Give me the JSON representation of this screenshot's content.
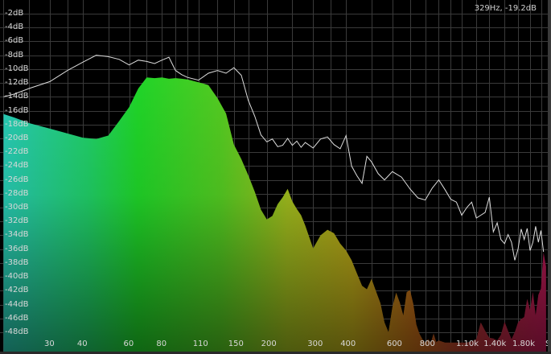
{
  "readout": {
    "frequency": "329Hz",
    "level": "-19.2dB",
    "text": "329Hz, -19.2dB"
  },
  "y_labels": [
    "-2dB",
    "-4dB",
    "-6dB",
    "-8dB",
    "-10dB",
    "-12dB",
    "-14dB",
    "-16dB",
    "-18dB",
    "-20dB",
    "-22dB",
    "-24dB",
    "-26dB",
    "-28dB",
    "-30dB",
    "-32dB",
    "-34dB",
    "-36dB",
    "-38dB",
    "-40dB",
    "-42dB",
    "-44dB",
    "-46dB",
    "-48dB"
  ],
  "x_labels": [
    "30",
    "40",
    "60",
    "80",
    "110",
    "150",
    "200",
    "300",
    "400",
    "600",
    "800",
    "1.10k",
    "1.40k",
    "1.80k",
    "S"
  ],
  "colors": {
    "background": "#000000",
    "grid": "#3a3a3a",
    "peak_line": "#dddddd",
    "spectrum_low": "#2ad3c0",
    "spectrum_mid": "#22e028",
    "spectrum_highmid": "#c9c21c",
    "spectrum_high": "#c2185b"
  },
  "chart_data": {
    "type": "area",
    "xscale": "log",
    "xlabel": "",
    "ylabel": "",
    "ylim": [
      -49,
      -1
    ],
    "xlim": [
      20,
      2300
    ],
    "grid": true,
    "series": [
      {
        "kind": "peak-hold",
        "x": [
          20,
          22,
          25,
          30,
          35,
          40,
          45,
          50,
          55,
          60,
          65,
          70,
          75,
          80,
          85,
          90,
          95,
          100,
          110,
          120,
          130,
          140,
          150,
          160,
          170,
          180,
          190,
          200,
          210,
          220,
          230,
          240,
          250,
          260,
          270,
          280,
          300,
          320,
          340,
          360,
          380,
          400,
          420,
          440,
          460,
          480,
          500,
          530,
          560,
          600,
          650,
          700,
          750,
          800,
          850,
          900,
          950,
          1000,
          1050,
          1100,
          1150,
          1200,
          1250,
          1300,
          1350,
          1400,
          1450,
          1500,
          1550,
          1600,
          1650,
          1700,
          1750,
          1800,
          1850,
          1900,
          1950,
          2000,
          2050,
          2100,
          2150,
          2200,
          2250
        ],
        "y": [
          -14,
          -13.6,
          -12.8,
          -11.8,
          -10.2,
          -9.0,
          -8.0,
          -8.2,
          -8.6,
          -9.4,
          -8.7,
          -8.9,
          -9.2,
          -8.7,
          -8.3,
          -10.2,
          -10.8,
          -11.2,
          -11.6,
          -10.6,
          -10.2,
          -10.6,
          -9.8,
          -10.9,
          -14.5,
          -16.8,
          -19.5,
          -20.5,
          -20.1,
          -21.2,
          -21.0,
          -20.0,
          -21.0,
          -20.4,
          -21.3,
          -20.6,
          -21.4,
          -20.1,
          -19.8,
          -20.9,
          -21.5,
          -19.6,
          -24.0,
          -25.4,
          -26.5,
          -22.6,
          -23.4,
          -25.1,
          -26.0,
          -24.8,
          -25.6,
          -27.3,
          -28.6,
          -28.9,
          -27.2,
          -26.0,
          -27.4,
          -28.8,
          -29.2,
          -31.1,
          -30.0,
          -29.2,
          -31.5,
          -31.1,
          -30.7,
          -28.5,
          -33.5,
          -32.2,
          -34.6,
          -35.2,
          -33.9,
          -35.0,
          -37.6,
          -36.0,
          -33.1,
          -34.6,
          -33.0,
          -36.2,
          -35.0,
          -32.7,
          -35.0,
          -33.3,
          -36.4
        ]
      },
      {
        "kind": "spectrum",
        "x": [
          20,
          22,
          25,
          30,
          35,
          40,
          45,
          50,
          55,
          60,
          65,
          70,
          75,
          80,
          85,
          90,
          95,
          100,
          110,
          120,
          130,
          140,
          150,
          160,
          170,
          180,
          190,
          200,
          210,
          220,
          230,
          240,
          250,
          260,
          270,
          280,
          300,
          320,
          340,
          360,
          380,
          400,
          420,
          440,
          460,
          480,
          500,
          520,
          540,
          560,
          580,
          600,
          620,
          640,
          660,
          680,
          700,
          720,
          740,
          760,
          780,
          800,
          820,
          840,
          860,
          880,
          900,
          950,
          1000,
          1050,
          1100,
          1150,
          1200,
          1250,
          1300,
          1350,
          1400,
          1450,
          1500,
          1550,
          1600,
          1650,
          1700,
          1750,
          1800,
          1850,
          1900,
          1950,
          2000,
          2050,
          2100,
          2150,
          2200,
          2250,
          2300
        ],
        "y": [
          -16.5,
          -17.0,
          -17.8,
          -18.6,
          -19.3,
          -19.9,
          -20.1,
          -19.6,
          -17.5,
          -15.5,
          -12.8,
          -11.2,
          -11.3,
          -11.2,
          -11.4,
          -11.3,
          -11.4,
          -11.5,
          -11.9,
          -12.3,
          -14.2,
          -16.4,
          -20.9,
          -23.0,
          -25.3,
          -27.7,
          -30.3,
          -31.7,
          -31.2,
          -29.5,
          -28.5,
          -27.3,
          -29.1,
          -30.2,
          -31.1,
          -32.6,
          -35.9,
          -34.0,
          -33.2,
          -33.7,
          -35.2,
          -36.2,
          -37.6,
          -39.5,
          -41.3,
          -41.8,
          -40.3,
          -42.1,
          -43.8,
          -46.6,
          -48.0,
          -44.4,
          -42.3,
          -43.7,
          -45.6,
          -42.2,
          -41.9,
          -43.9,
          -46.9,
          -48.2,
          -49.0,
          -49.5,
          -49.0,
          -49.5,
          -48.2,
          -49.4,
          -49.2,
          -49.5,
          -49.5,
          -49.5,
          -49.5,
          -49.5,
          -49.3,
          -49.0,
          -46.6,
          -47.8,
          -48.8,
          -48.9,
          -49.2,
          -48.4,
          -46.5,
          -47.8,
          -49.0,
          -48.0,
          -46.6,
          -46.1,
          -45.8,
          -43.2,
          -44.8,
          -42.2,
          -45.6,
          -42.6,
          -41.7,
          -36.5,
          -38.5
        ]
      }
    ]
  }
}
